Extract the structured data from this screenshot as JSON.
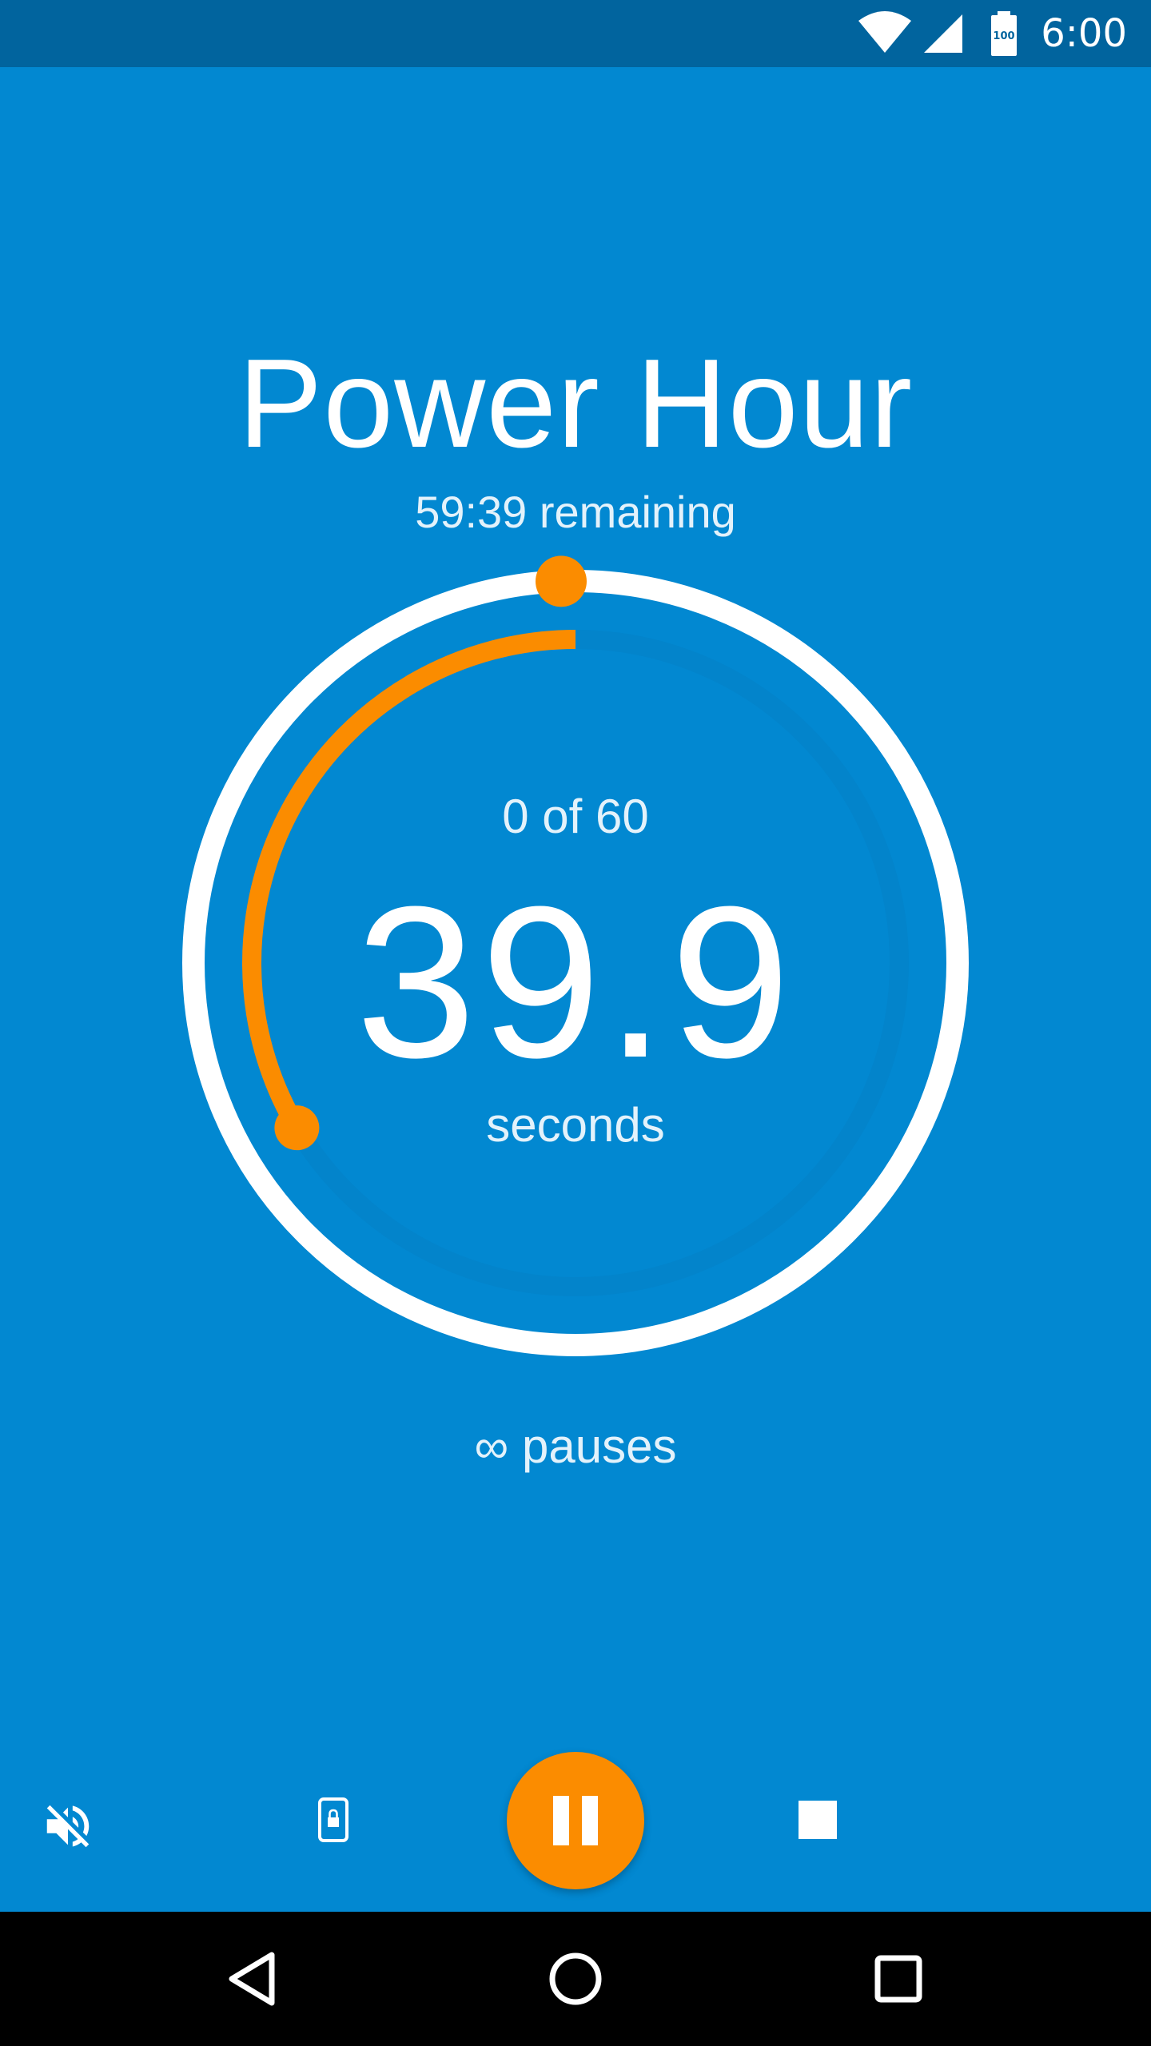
{
  "status_bar": {
    "time": "6:00",
    "battery_level": "100",
    "icons": [
      "wifi-icon",
      "cell-signal-icon",
      "battery-icon"
    ]
  },
  "timer": {
    "title": "Power Hour",
    "remaining": "59:39 remaining",
    "round_counter": "0 of 60",
    "countdown": "39.9",
    "countdown_unit": "seconds",
    "pauses": "∞ pauses",
    "round_progress_fraction": 0.335,
    "hour_progress_fraction": 0.006
  },
  "colors": {
    "background": "#0288D1",
    "status_bar": "#01649E",
    "accent": "#FB8C00",
    "ring": "#FFFFFF",
    "track": "#0384CB"
  },
  "controls": {
    "mute": "volume-off-icon",
    "lock": "screen-lock-icon",
    "pause": "pause-icon",
    "stop": "stop-icon"
  },
  "nav_bar": {
    "icons": [
      "back-icon",
      "home-icon",
      "recents-icon"
    ]
  }
}
